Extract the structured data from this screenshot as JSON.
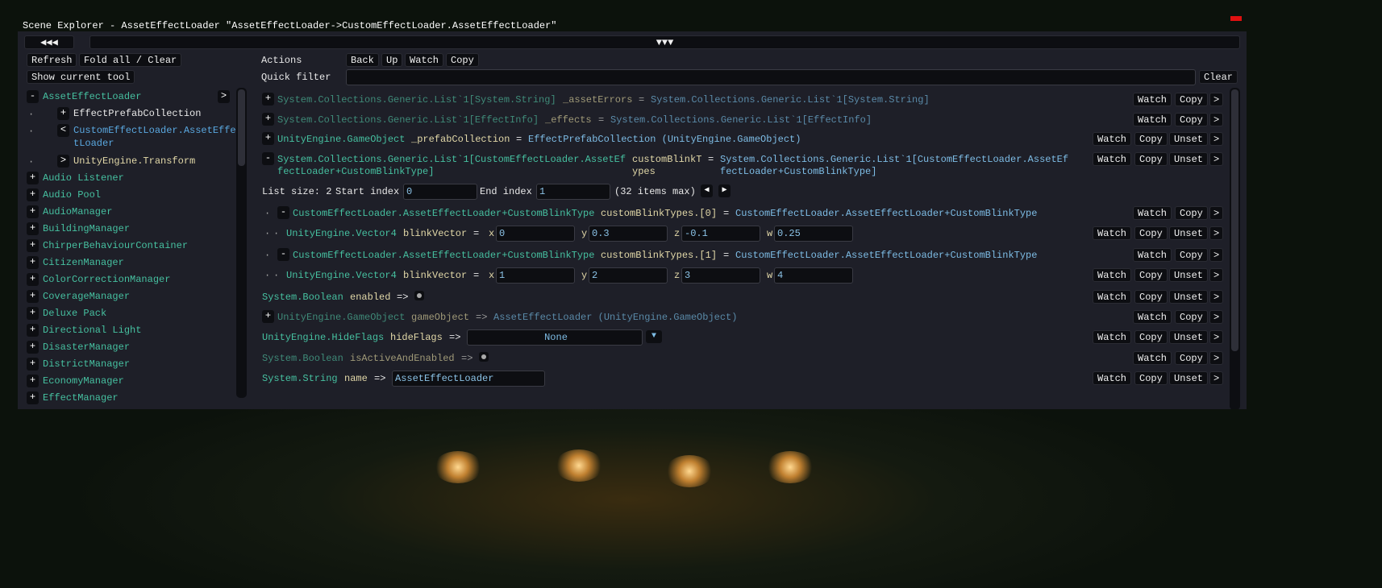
{
  "window": {
    "title": "Scene Explorer - AssetEffectLoader \"AssetEffectLoader->CustomEffectLoader.AssetEffectLoader\"",
    "collapse_left": "◀◀◀",
    "collapse_top": "▼▼▼"
  },
  "left": {
    "refresh": "Refresh",
    "fold_all": "Fold all / Clear",
    "show_current_tool": "Show current tool",
    "tree": [
      {
        "label": "AssetEffectLoader",
        "toggle": "-",
        "level": 0,
        "color": "teal",
        "goto": ">"
      },
      {
        "label": "EffectPrefabCollection",
        "toggle": "+",
        "level": 1,
        "color": "white"
      },
      {
        "label": "CustomEffectLoader.AssetEffec",
        "label2": "tLoader",
        "toggle": "<",
        "level": 1,
        "color": "blue"
      },
      {
        "label": "UnityEngine.Transform",
        "toggle": ">",
        "level": 1,
        "color": "yellow"
      },
      {
        "label": "Audio Listener",
        "toggle": "+",
        "level": 0,
        "color": "teal"
      },
      {
        "label": "Audio Pool",
        "toggle": "+",
        "level": 0,
        "color": "teal"
      },
      {
        "label": "AudioManager",
        "toggle": "+",
        "level": 0,
        "color": "teal"
      },
      {
        "label": "BuildingManager",
        "toggle": "+",
        "level": 0,
        "color": "teal"
      },
      {
        "label": "ChirperBehaviourContainer",
        "toggle": "+",
        "level": 0,
        "color": "teal"
      },
      {
        "label": "CitizenManager",
        "toggle": "+",
        "level": 0,
        "color": "teal"
      },
      {
        "label": "ColorCorrectionManager",
        "toggle": "+",
        "level": 0,
        "color": "teal"
      },
      {
        "label": "CoverageManager",
        "toggle": "+",
        "level": 0,
        "color": "teal"
      },
      {
        "label": "Deluxe Pack",
        "toggle": "+",
        "level": 0,
        "color": "teal"
      },
      {
        "label": "Directional Light",
        "toggle": "+",
        "level": 0,
        "color": "teal"
      },
      {
        "label": "DisasterManager",
        "toggle": "+",
        "level": 0,
        "color": "teal"
      },
      {
        "label": "DistrictManager",
        "toggle": "+",
        "level": 0,
        "color": "teal"
      },
      {
        "label": "EconomyManager",
        "toggle": "+",
        "level": 0,
        "color": "teal"
      },
      {
        "label": "EffectManager",
        "toggle": "+",
        "level": 0,
        "color": "teal"
      }
    ]
  },
  "actions": {
    "label": "Actions",
    "back": "Back",
    "up": "Up",
    "watch": "Watch",
    "copy": "Copy",
    "quick_filter_label": "Quick filter",
    "quick_filter_value": "",
    "clear": "Clear"
  },
  "buttons": {
    "watch": "Watch",
    "copy": "Copy",
    "unset": "Unset",
    "goto": ">"
  },
  "list": {
    "size_label": "List size: 2",
    "start_label": "Start index",
    "start_value": "0",
    "end_label": "End index",
    "end_value": "1",
    "max_label": "(32 items max)",
    "prev": "◀",
    "next": "▶"
  },
  "rows": [
    {
      "toggle": "+",
      "type": "System.Collections.Generic.List`1[System.String]",
      "name": "_assetErrors",
      "op": "=",
      "value": "System.Collections.Generic.List`1[System.String]",
      "dim": true,
      "unset": false,
      "goto": true
    },
    {
      "toggle": "+",
      "type": "System.Collections.Generic.List`1[EffectInfo]",
      "name": "_effects",
      "op": "=",
      "value": "System.Collections.Generic.List`1[EffectInfo]",
      "dim": true,
      "unset": false,
      "goto": true
    },
    {
      "toggle": "+",
      "type": "UnityEngine.GameObject",
      "name": "_prefabCollection",
      "op": "=",
      "value": "EffectPrefabCollection (UnityEngine.GameObject)",
      "unset": true,
      "goto": true
    },
    {
      "toggle": "-",
      "type": "System.Collections.Generic.List`1[CustomEffectLoader.AssetEf",
      "type2": "fectLoader+CustomBlinkType]",
      "name": "customBlinkT",
      "name2": "ypes",
      "op": "=",
      "value": "System.Collections.Generic.List`1[CustomEffectLoader.AssetEf",
      "value2": "fectLoader+CustomBlinkType]",
      "unset": true,
      "goto": true
    },
    {
      "listctl": true
    },
    {
      "dots": 1,
      "toggle": "-",
      "type": "CustomEffectLoader.AssetEffectLoader+CustomBlinkType",
      "name": "customBlinkTypes.[0]",
      "op": "=",
      "value": "CustomEffectLoader.AssetEffectLoader+CustomBlinkType",
      "unset": false,
      "goto": true
    },
    {
      "dots": 2,
      "type": "UnityEngine.Vector4",
      "name": "blinkVector",
      "op": "=",
      "vec": {
        "x": "0",
        "y": "0.3",
        "z": "-0.1",
        "w": "0.25"
      },
      "unset": true,
      "goto": true
    },
    {
      "dots": 1,
      "toggle": "-",
      "type": "CustomEffectLoader.AssetEffectLoader+CustomBlinkType",
      "name": "customBlinkTypes.[1]",
      "op": "=",
      "value": "CustomEffectLoader.AssetEffectLoader+CustomBlinkType",
      "unset": false,
      "goto": true
    },
    {
      "dots": 2,
      "type": "UnityEngine.Vector4",
      "name": "blinkVector",
      "op": "=",
      "vec": {
        "x": "1",
        "y": "2",
        "z": "3",
        "w": "4"
      },
      "unset": true,
      "goto": true
    },
    {
      "type": "System.Boolean",
      "name": "enabled",
      "op": "=>",
      "check": true,
      "unset": true,
      "goto": true
    },
    {
      "toggle": "+",
      "type": "UnityEngine.GameObject",
      "name": "gameObject",
      "op": "=>",
      "value": "AssetEffectLoader (UnityEngine.GameObject)",
      "dim": true,
      "unset": false,
      "goto": true
    },
    {
      "type": "UnityEngine.HideFlags",
      "name": "hideFlags",
      "op": "=>",
      "dropdown": "None",
      "unset": true,
      "goto": true
    },
    {
      "type": "System.Boolean",
      "name": "isActiveAndEnabled",
      "op": "=>",
      "check": true,
      "dim": true,
      "unset": false,
      "goto": true
    },
    {
      "type": "System.String",
      "name": "name",
      "op": "=>",
      "text": "AssetEffectLoader",
      "unset": true,
      "goto": true
    }
  ]
}
